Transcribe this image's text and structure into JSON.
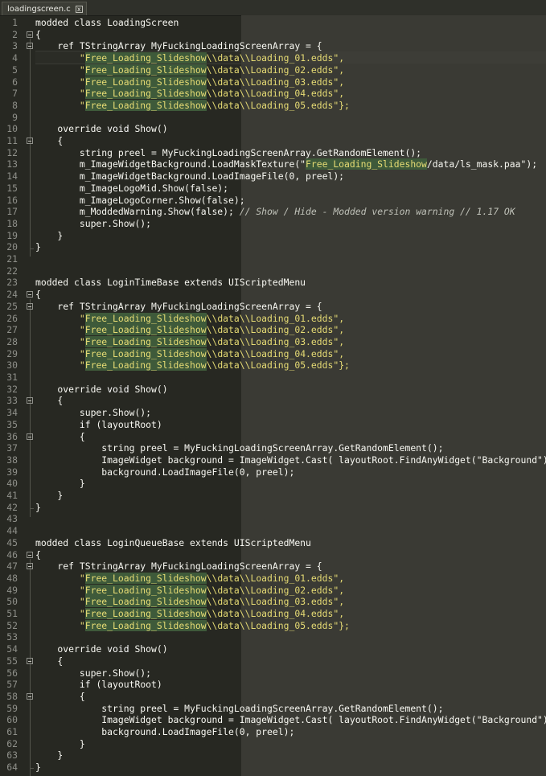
{
  "tab": {
    "title": "loadingscreen.c",
    "close_label": "x"
  },
  "lines": [
    {
      "n": "1",
      "t": [
        [
          "modded class LoadingScreen",
          ""
        ]
      ]
    },
    {
      "n": "2",
      "t": [
        [
          "{",
          ""
        ]
      ]
    },
    {
      "n": "3",
      "t": [
        [
          "    ref TStringArray MyFuckingLoadingScreenArray = {",
          ""
        ]
      ]
    },
    {
      "n": "4",
      "t": [
        [
          "        \"",
          ""
        ],
        [
          "Free_Loading_Slideshow",
          "hl"
        ],
        [
          "\\\\data\\\\Loading_01.edds\",",
          ""
        ]
      ]
    },
    {
      "n": "5",
      "t": [
        [
          "        \"",
          ""
        ],
        [
          "Free_Loading_Slideshow",
          "hl"
        ],
        [
          "\\\\data\\\\Loading_02.edds\",",
          ""
        ]
      ]
    },
    {
      "n": "6",
      "t": [
        [
          "        \"",
          ""
        ],
        [
          "Free_Loading_Slideshow",
          "hl"
        ],
        [
          "\\\\data\\\\Loading_03.edds\",",
          ""
        ]
      ]
    },
    {
      "n": "7",
      "t": [
        [
          "        \"",
          ""
        ],
        [
          "Free_Loading_Slideshow",
          "hl"
        ],
        [
          "\\\\data\\\\Loading_04.edds\",",
          ""
        ]
      ]
    },
    {
      "n": "8",
      "t": [
        [
          "        \"",
          ""
        ],
        [
          "Free_Loading_Slideshow",
          "hl"
        ],
        [
          "\\\\data\\\\Loading_05.edds\"};",
          ""
        ]
      ]
    },
    {
      "n": "9",
      "t": []
    },
    {
      "n": "10",
      "t": [
        [
          "    override ",
          ""
        ],
        [
          "void",
          "kw"
        ],
        [
          " Show()",
          ""
        ]
      ]
    },
    {
      "n": "11",
      "t": [
        [
          "    {",
          ""
        ]
      ]
    },
    {
      "n": "12",
      "t": [
        [
          "        string preel = MyFuckingLoadingScreenArray.GetRandomElement();",
          ""
        ]
      ]
    },
    {
      "n": "13",
      "t": [
        [
          "        m_ImageWidgetBackground.LoadMaskTexture(\"",
          ""
        ],
        [
          "Free_Loading_Slideshow",
          "hl"
        ],
        [
          "/data/ls_mask.paa\");",
          ""
        ]
      ]
    },
    {
      "n": "14",
      "t": [
        [
          "        m_ImageWidgetBackground.LoadImageFile(0, preel);",
          ""
        ]
      ]
    },
    {
      "n": "15",
      "t": [
        [
          "        m_ImageLogoMid.Show(false);",
          ""
        ]
      ]
    },
    {
      "n": "16",
      "t": [
        [
          "        m_ImageLogoCorner.Show(false);",
          ""
        ]
      ]
    },
    {
      "n": "17",
      "t": [
        [
          "        m_ModdedWarning.Show(false); ",
          ""
        ],
        [
          "// Show / Hide - Modded version warning // 1.17 OK",
          "cm"
        ]
      ]
    },
    {
      "n": "18",
      "t": [
        [
          "        super.Show();",
          ""
        ]
      ]
    },
    {
      "n": "19",
      "t": [
        [
          "    }",
          ""
        ]
      ]
    },
    {
      "n": "20",
      "t": [
        [
          "}",
          ""
        ]
      ]
    },
    {
      "n": "21",
      "t": []
    },
    {
      "n": "22",
      "t": []
    },
    {
      "n": "23",
      "t": [
        [
          "modded class LoginTimeBase extends UIScriptedMenu",
          ""
        ]
      ]
    },
    {
      "n": "24",
      "t": [
        [
          "{",
          ""
        ]
      ]
    },
    {
      "n": "25",
      "t": [
        [
          "    ref TStringArray MyFuckingLoadingScreenArray = {",
          ""
        ]
      ]
    },
    {
      "n": "26",
      "t": [
        [
          "        \"",
          ""
        ],
        [
          "Free_Loading_Slideshow",
          "hl"
        ],
        [
          "\\\\data\\\\Loading_01.edds\",",
          ""
        ]
      ]
    },
    {
      "n": "27",
      "t": [
        [
          "        \"",
          ""
        ],
        [
          "Free_Loading_Slideshow",
          "hl"
        ],
        [
          "\\\\data\\\\Loading_02.edds\",",
          ""
        ]
      ]
    },
    {
      "n": "28",
      "t": [
        [
          "        \"",
          ""
        ],
        [
          "Free_Loading_Slideshow",
          "hl"
        ],
        [
          "\\\\data\\\\Loading_03.edds\",",
          ""
        ]
      ]
    },
    {
      "n": "29",
      "t": [
        [
          "        \"",
          ""
        ],
        [
          "Free_Loading_Slideshow",
          "hl"
        ],
        [
          "\\\\data\\\\Loading_04.edds\",",
          ""
        ]
      ]
    },
    {
      "n": "30",
      "t": [
        [
          "        \"",
          ""
        ],
        [
          "Free_Loading_Slideshow",
          "hl"
        ],
        [
          "\\\\data\\\\Loading_05.edds\"};",
          ""
        ]
      ]
    },
    {
      "n": "31",
      "t": []
    },
    {
      "n": "32",
      "t": [
        [
          "    override ",
          ""
        ],
        [
          "void",
          "kw"
        ],
        [
          " Show()",
          ""
        ]
      ]
    },
    {
      "n": "33",
      "t": [
        [
          "    {",
          ""
        ]
      ]
    },
    {
      "n": "34",
      "t": [
        [
          "        super.Show();",
          ""
        ]
      ]
    },
    {
      "n": "35",
      "t": [
        [
          "        ",
          ""
        ],
        [
          "if",
          "kw"
        ],
        [
          " (layoutRoot)",
          ""
        ]
      ]
    },
    {
      "n": "36",
      "t": [
        [
          "        {",
          ""
        ]
      ]
    },
    {
      "n": "37",
      "t": [
        [
          "            string preel = MyFuckingLoadingScreenArray.GetRandomElement();",
          ""
        ]
      ]
    },
    {
      "n": "38",
      "t": [
        [
          "            ImageWidget background = ImageWidget.Cast( layoutRoot.FindAnyWidget(\"Background\"));",
          ""
        ]
      ]
    },
    {
      "n": "39",
      "t": [
        [
          "            background.LoadImageFile(0, preel);",
          ""
        ]
      ]
    },
    {
      "n": "40",
      "t": [
        [
          "        }",
          ""
        ]
      ]
    },
    {
      "n": "41",
      "t": [
        [
          "    }",
          ""
        ]
      ]
    },
    {
      "n": "42",
      "t": [
        [
          "}",
          ""
        ]
      ]
    },
    {
      "n": "43",
      "t": []
    },
    {
      "n": "44",
      "t": []
    },
    {
      "n": "45",
      "t": [
        [
          "modded class LoginQueueBase extends UIScriptedMenu",
          ""
        ]
      ]
    },
    {
      "n": "46",
      "t": [
        [
          "{",
          ""
        ]
      ]
    },
    {
      "n": "47",
      "t": [
        [
          "    ref TStringArray MyFuckingLoadingScreenArray = {",
          ""
        ]
      ]
    },
    {
      "n": "48",
      "t": [
        [
          "        \"",
          ""
        ],
        [
          "Free_Loading_Slideshow",
          "hl"
        ],
        [
          "\\\\data\\\\Loading_01.edds\",",
          ""
        ]
      ]
    },
    {
      "n": "49",
      "t": [
        [
          "        \"",
          ""
        ],
        [
          "Free_Loading_Slideshow",
          "hl"
        ],
        [
          "\\\\data\\\\Loading_02.edds\",",
          ""
        ]
      ]
    },
    {
      "n": "50",
      "t": [
        [
          "        \"",
          ""
        ],
        [
          "Free_Loading_Slideshow",
          "hl"
        ],
        [
          "\\\\data\\\\Loading_03.edds\",",
          ""
        ]
      ]
    },
    {
      "n": "51",
      "t": [
        [
          "        \"",
          ""
        ],
        [
          "Free_Loading_Slideshow",
          "hl"
        ],
        [
          "\\\\data\\\\Loading_04.edds\",",
          ""
        ]
      ]
    },
    {
      "n": "52",
      "t": [
        [
          "        \"",
          ""
        ],
        [
          "Free_Loading_Slideshow",
          "hl"
        ],
        [
          "\\\\data\\\\Loading_05.edds\"};",
          ""
        ]
      ]
    },
    {
      "n": "53",
      "t": []
    },
    {
      "n": "54",
      "t": [
        [
          "    override ",
          ""
        ],
        [
          "void",
          "kw"
        ],
        [
          " Show()",
          ""
        ]
      ]
    },
    {
      "n": "55",
      "t": [
        [
          "    {",
          ""
        ]
      ]
    },
    {
      "n": "56",
      "t": [
        [
          "        super.Show();",
          ""
        ]
      ]
    },
    {
      "n": "57",
      "t": [
        [
          "        ",
          ""
        ],
        [
          "if",
          "kw"
        ],
        [
          " (layoutRoot)",
          ""
        ]
      ]
    },
    {
      "n": "58",
      "t": [
        [
          "        {",
          ""
        ]
      ]
    },
    {
      "n": "59",
      "t": [
        [
          "            string preel = MyFuckingLoadingScreenArray.GetRandomElement();",
          ""
        ]
      ]
    },
    {
      "n": "60",
      "t": [
        [
          "            ImageWidget background = ImageWidget.Cast( layoutRoot.FindAnyWidget(\"Background\"));",
          ""
        ]
      ]
    },
    {
      "n": "61",
      "t": [
        [
          "            background.LoadImageFile(0, preel);",
          ""
        ]
      ]
    },
    {
      "n": "62",
      "t": [
        [
          "        }",
          ""
        ]
      ]
    },
    {
      "n": "63",
      "t": [
        [
          "    }",
          ""
        ]
      ]
    },
    {
      "n": "64",
      "t": [
        [
          "}",
          ""
        ]
      ]
    }
  ],
  "folds": [
    "2",
    "3",
    "11",
    "24",
    "25",
    "33",
    "36",
    "46",
    "47",
    "55",
    "58"
  ]
}
